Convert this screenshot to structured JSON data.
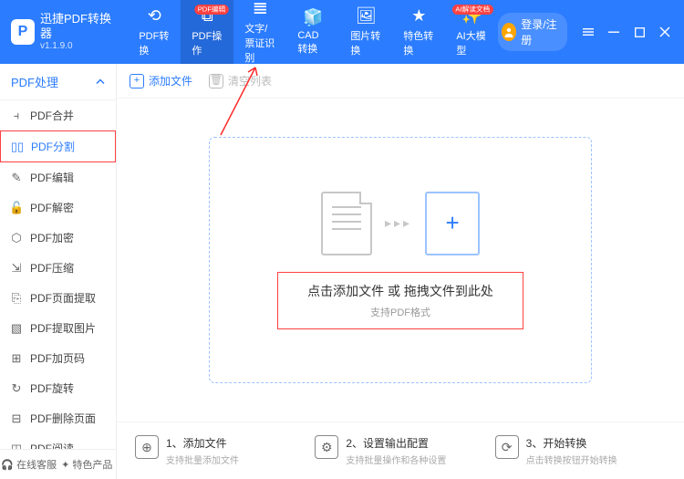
{
  "app": {
    "title": "迅捷PDF转换器",
    "version": "v1.1.9.0"
  },
  "top_tabs": [
    {
      "label": "PDF转换",
      "badge": null
    },
    {
      "label": "PDF操作",
      "badge": "PDF编辑",
      "active": true
    },
    {
      "label": "文字/票证识别",
      "badge": null
    },
    {
      "label": "CAD转换",
      "badge": null
    },
    {
      "label": "图片转换",
      "badge": null
    },
    {
      "label": "特色转换",
      "badge": null
    },
    {
      "label": "AI大模型",
      "badge": "AI解读文档"
    }
  ],
  "login_label": "登录/注册",
  "sidebar": {
    "header": "PDF处理",
    "items": [
      {
        "label": "PDF合并",
        "icon": "⫞"
      },
      {
        "label": "PDF分割",
        "icon": "▯▯",
        "selected": true
      },
      {
        "label": "PDF编辑",
        "icon": "✎"
      },
      {
        "label": "PDF解密",
        "icon": "🔓"
      },
      {
        "label": "PDF加密",
        "icon": "⬡"
      },
      {
        "label": "PDF压缩",
        "icon": "⇲"
      },
      {
        "label": "PDF页面提取",
        "icon": "⎘"
      },
      {
        "label": "PDF提取图片",
        "icon": "▧"
      },
      {
        "label": "PDF加页码",
        "icon": "⊞"
      },
      {
        "label": "PDF旋转",
        "icon": "↻"
      },
      {
        "label": "PDF删除页面",
        "icon": "⊟"
      },
      {
        "label": "PDF阅读",
        "icon": "◫"
      }
    ],
    "footer": {
      "support": "在线客服",
      "featured": "特色产品"
    }
  },
  "toolbar": {
    "add_file": "添加文件",
    "clear_list": "清空列表"
  },
  "dropzone": {
    "line1": "点击添加文件 或 拖拽文件到此处",
    "line2": "支持PDF格式"
  },
  "steps": [
    {
      "num": "1、",
      "title": "添加文件",
      "desc": "支持批量添加文件"
    },
    {
      "num": "2、",
      "title": "设置输出配置",
      "desc": "支持批量操作和各种设置"
    },
    {
      "num": "3、",
      "title": "开始转换",
      "desc": "点击转换按钮开始转换"
    }
  ]
}
